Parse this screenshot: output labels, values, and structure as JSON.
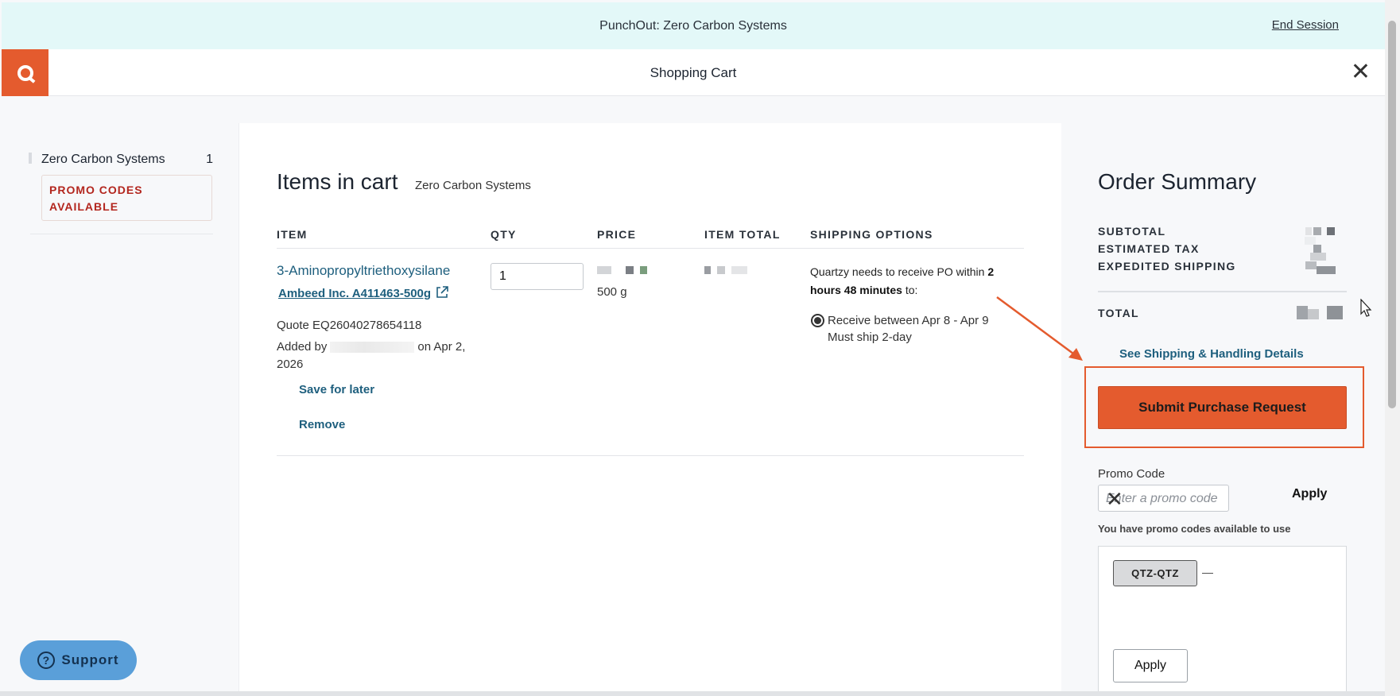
{
  "banner": {
    "text": "PunchOut: Zero Carbon Systems",
    "end_session": "End Session"
  },
  "header": {
    "title": "Shopping Cart"
  },
  "sidebar": {
    "vendor": {
      "name": "Zero Carbon Systems",
      "count": "1"
    },
    "promo_badge": "PROMO CODES AVAILABLE"
  },
  "support": {
    "label": "Support"
  },
  "cart": {
    "title": "Items in cart",
    "vendor": "Zero Carbon Systems",
    "columns": [
      "ITEM",
      "QTY",
      "PRICE",
      "ITEM TOTAL",
      "SHIPPING OPTIONS"
    ],
    "item": {
      "name": "3-Aminopropyltriethoxysilane",
      "sku": "Ambeed Inc. A411463-500g",
      "quote": "Quote EQ26040278654118",
      "added_prefix": "Added by",
      "added_suffix": "on Apr 2, 2026",
      "save_for_later": "Save for later",
      "remove": "Remove",
      "qty": "1",
      "unit": "500 g",
      "shipping_prefix": "Quartzy needs to receive PO within",
      "shipping_bold": "2 hours 48 minutes",
      "shipping_suffix": "to:",
      "receive_window": "Receive between Apr 8 - Apr 9",
      "ship_method": "Must ship 2-day"
    }
  },
  "summary": {
    "title": "Order Summary",
    "subtotal_label": "SUBTOTAL",
    "tax_label": "ESTIMATED TAX",
    "shipping_label": "EXPEDITED SHIPPING",
    "total_label": "TOTAL",
    "shipping_details_link": "See Shipping & Handling Details",
    "submit_label": "Submit Purchase Request",
    "promo_label": "Promo Code",
    "promo_placeholder": "Enter a promo code",
    "apply_label": "Apply",
    "promo_note": "You have promo codes available to use",
    "promo_code": "QTZ-QTZ",
    "promo_dash": "—",
    "apply_button": "Apply"
  },
  "colors": {
    "brand": "#e45b2e",
    "banner": "#e3f8f8",
    "link": "#1e5f7e",
    "support": "#5a9fd9",
    "promo_red": "#b3261e"
  }
}
